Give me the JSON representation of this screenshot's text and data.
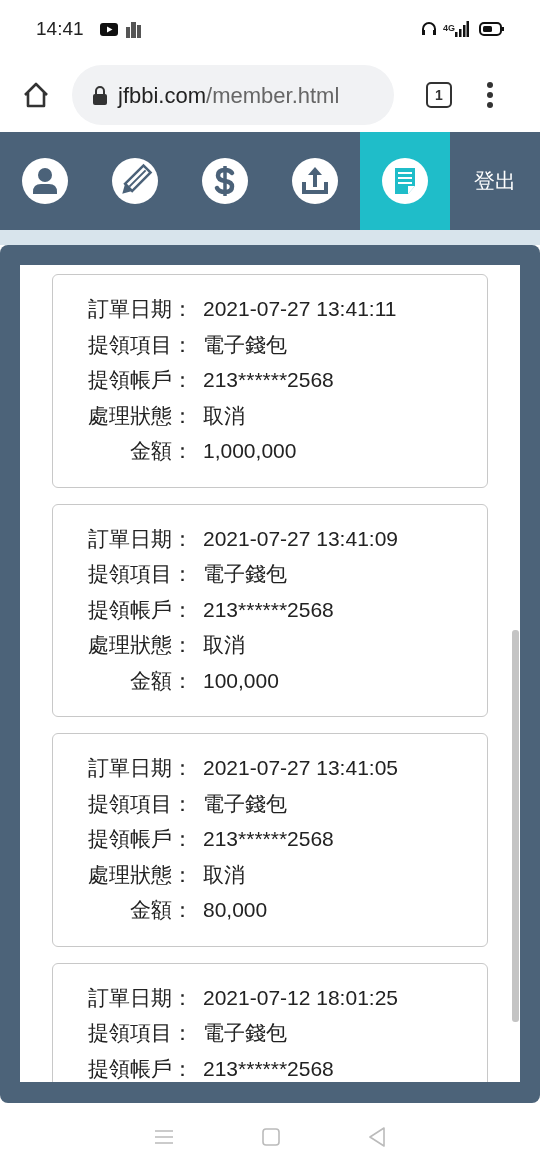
{
  "status_bar": {
    "time": "14:41",
    "network": "4G"
  },
  "browser": {
    "url_host": "jfbbi.com",
    "url_path": "/member.html",
    "tab_count": "1"
  },
  "nav": {
    "items": [
      {
        "kind": "profile",
        "selected": false
      },
      {
        "kind": "edit",
        "selected": false
      },
      {
        "kind": "money",
        "selected": false
      },
      {
        "kind": "upload",
        "selected": false
      },
      {
        "kind": "records",
        "selected": true
      }
    ],
    "logout": "登出"
  },
  "orders": [
    {
      "fields": [
        {
          "label": "訂單日期：",
          "value": "2021-07-27 13:41:11"
        },
        {
          "label": "提領項目：",
          "value": "電子錢包"
        },
        {
          "label": "提領帳戶：",
          "value": "213******2568"
        },
        {
          "label": "處理狀態：",
          "value": "取消"
        },
        {
          "label": "金額：",
          "value": "1,000,000"
        }
      ]
    },
    {
      "fields": [
        {
          "label": "訂單日期：",
          "value": "2021-07-27 13:41:09"
        },
        {
          "label": "提領項目：",
          "value": "電子錢包"
        },
        {
          "label": "提領帳戶：",
          "value": "213******2568"
        },
        {
          "label": "處理狀態：",
          "value": "取消"
        },
        {
          "label": "金額：",
          "value": "100,000"
        }
      ]
    },
    {
      "fields": [
        {
          "label": "訂單日期：",
          "value": "2021-07-27 13:41:05"
        },
        {
          "label": "提領項目：",
          "value": "電子錢包"
        },
        {
          "label": "提領帳戶：",
          "value": "213******2568"
        },
        {
          "label": "處理狀態：",
          "value": "取消"
        },
        {
          "label": "金額：",
          "value": "80,000"
        }
      ]
    },
    {
      "fields": [
        {
          "label": "訂單日期：",
          "value": "2021-07-12 18:01:25"
        },
        {
          "label": "提領項目：",
          "value": "電子錢包"
        },
        {
          "label": "提領帳戶：",
          "value": "213******2568"
        }
      ]
    }
  ]
}
